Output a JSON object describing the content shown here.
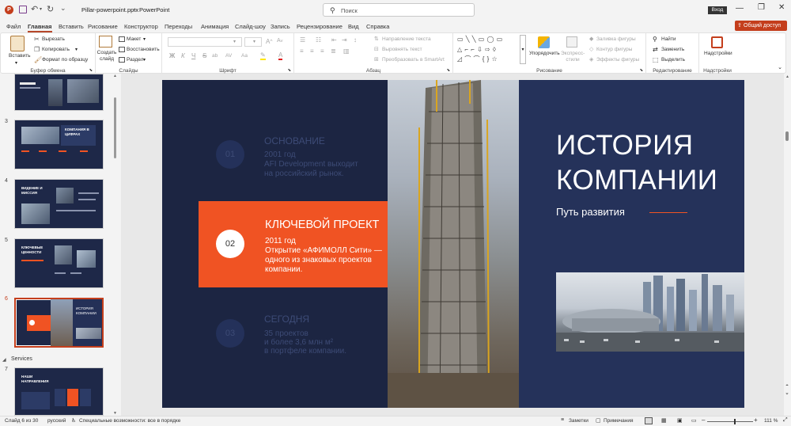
{
  "titlebar": {
    "filename": "Pillar-powerpoint.pptx",
    "separator": "-",
    "app": "PowerPoint",
    "search_placeholder": "Поиск",
    "signin": "Вход"
  },
  "menu": {
    "tabs": [
      "Файл",
      "Главная",
      "Вставить",
      "Рисование",
      "Конструктор",
      "Переходы",
      "Анимация",
      "Слайд-шоу",
      "Запись",
      "Рецензирование",
      "Вид",
      "Справка"
    ],
    "share": "Общий доступ"
  },
  "ribbon": {
    "clipboard": {
      "paste": "Вставить",
      "cut": "Вырезать",
      "copy": "Копировать",
      "format_painter": "Формат по образцу",
      "label": "Буфер обмена"
    },
    "slides": {
      "new_slide": "Создать слайд",
      "layout": "Макет",
      "reset": "Восстановить",
      "section": "Раздел",
      "label": "Слайды"
    },
    "font": {
      "label": "Шрифт",
      "buttons": [
        "Ж",
        "К",
        "Ч",
        "S",
        "ab",
        "AV",
        "Aa"
      ]
    },
    "paragraph": {
      "direction": "Направление текста",
      "align": "Выровнять текст",
      "smartart": "Преобразовать в SmartArt",
      "label": "Абзац"
    },
    "drawing": {
      "arrange": "Упорядочить",
      "quick_styles": "Экспресс-стили",
      "fill": "Заливка фигуры",
      "outline": "Контур фигуры",
      "effects": "Эффекты фигуры",
      "label": "Рисование"
    },
    "editing": {
      "find": "Найти",
      "replace": "Заменить",
      "select": "Выделить",
      "label": "Редактирование"
    },
    "addins": {
      "button": "Надстройки",
      "label": "Надстройки"
    }
  },
  "sidebar": {
    "slides": [
      {
        "num": "3",
        "title": "КОМПАНИЯ В ЦИФРАХ"
      },
      {
        "num": "4",
        "title": "ВИДЕНИЕ И МИССИЯ"
      },
      {
        "num": "5",
        "title": "КЛЮЧЕВЫЕ ЦЕННОСТИ"
      },
      {
        "num": "6",
        "title": "ИСТОРИЯ КОМПАНИИ"
      },
      {
        "num": "7",
        "title": "НАШИ НАПРАВЛЕНИЯ"
      }
    ],
    "section": "Services"
  },
  "slide": {
    "title_line1": "ИСТОРИЯ",
    "title_line2": "КОМПАНИИ",
    "subtitle": "Путь развития",
    "items": [
      {
        "num": "01",
        "heading": "ОСНОВАНИЕ",
        "line1": "2001 год",
        "line2": "AFI Development выходит",
        "line3": "на российский рынок."
      },
      {
        "num": "02",
        "heading": "КЛЮЧЕВОЙ ПРОЕКТ",
        "line1": "2011 год",
        "line2": "Открытие «АФИМОЛЛ Сити» —",
        "line3": "одного из знаковых проектов",
        "line4": "компании."
      },
      {
        "num": "03",
        "heading": "СЕГОДНЯ",
        "line1": "35 проектов",
        "line2": "и более 3,6 млн м²",
        "line3": "в портфеле компании."
      }
    ]
  },
  "status": {
    "slide_info": "Слайд 6 из 30",
    "language": "русский",
    "accessibility": "Специальные возможности: все в порядке",
    "notes": "Заметки",
    "comments": "Примечания",
    "zoom": "111 %"
  },
  "colors": {
    "accent": "#b7472a",
    "slide_bg": "#1c2542",
    "orange": "#f05323",
    "navy_panel": "#25325a",
    "share_btn": "#c43e1c"
  }
}
